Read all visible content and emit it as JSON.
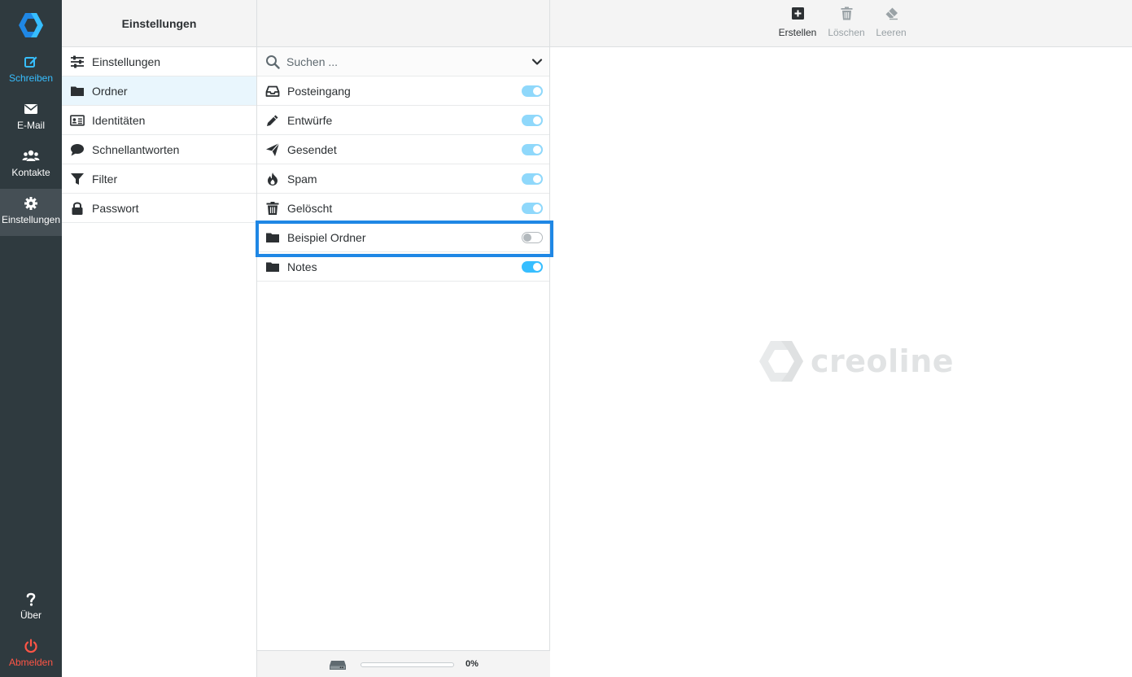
{
  "rail": {
    "items": [
      {
        "label": "Schreiben",
        "icon": "compose-icon"
      },
      {
        "label": "E-Mail",
        "icon": "mail-icon"
      },
      {
        "label": "Kontakte",
        "icon": "contacts-icon"
      },
      {
        "label": "Einstellungen",
        "icon": "gear-icon"
      }
    ],
    "about_label": "Über",
    "logout_label": "Abmelden"
  },
  "settings": {
    "title": "Einstellungen",
    "sections": [
      {
        "label": "Einstellungen",
        "icon": "sliders-icon"
      },
      {
        "label": "Ordner",
        "icon": "folder-icon"
      },
      {
        "label": "Identitäten",
        "icon": "id-card-icon"
      },
      {
        "label": "Schnellantworten",
        "icon": "speech-bubble-icon"
      },
      {
        "label": "Filter",
        "icon": "filter-icon"
      },
      {
        "label": "Passwort",
        "icon": "lock-icon"
      }
    ]
  },
  "folders": {
    "search_placeholder": "Suchen ...",
    "items": [
      {
        "name": "Posteingang",
        "icon": "inbox-icon",
        "subscribed": true
      },
      {
        "name": "Entwürfe",
        "icon": "pencil-icon",
        "subscribed": true
      },
      {
        "name": "Gesendet",
        "icon": "paper-plane-icon",
        "subscribed": true
      },
      {
        "name": "Spam",
        "icon": "fire-icon",
        "subscribed": true
      },
      {
        "name": "Gelöscht",
        "icon": "trash-icon",
        "subscribed": true
      },
      {
        "name": "Beispiel Ordner",
        "icon": "folder-icon",
        "subscribed": false
      },
      {
        "name": "Notes",
        "icon": "folder-icon",
        "subscribed": true
      }
    ],
    "quota_percent": 0,
    "quota_label": "0%"
  },
  "toolbar": {
    "create_label": "Erstellen",
    "delete_label": "Löschen",
    "empty_label": "Leeren"
  },
  "watermark": {
    "text": "creoline"
  },
  "colors": {
    "rail_bg": "#2f3a3f",
    "accent": "#37beff",
    "logout": "#ff5546",
    "highlight": "#1f87e5"
  }
}
